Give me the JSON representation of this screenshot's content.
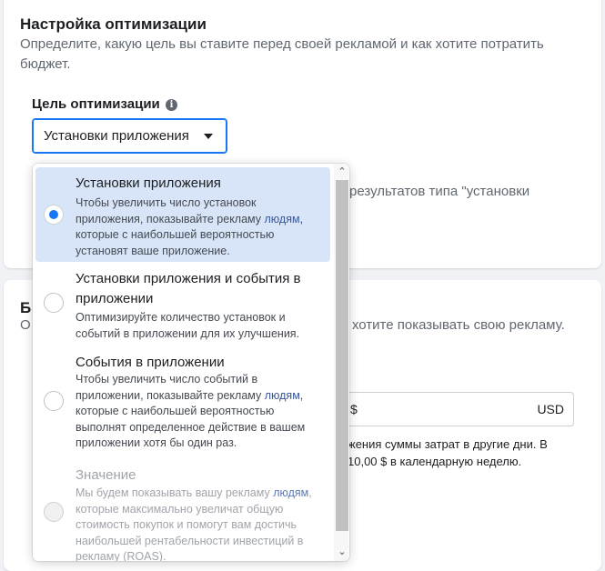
{
  "optimization": {
    "title": "Настройка оптимизации",
    "description": "Определите, какую цель вы ставите перед своей рекламой и как хотите потратить бюджет.",
    "goal_label": "Цель оптимизации",
    "goal_value": "Установки приложения",
    "behind_text": "результатов типа \"установки"
  },
  "budget": {
    "title_partial": "Б",
    "desc_left": "О",
    "desc_right": "ы хотите показывать свою рекламу.",
    "currency_symbol": "$",
    "currency_unit": "USD",
    "note_line1": "жения суммы затрат в другие дни. В",
    "note_line2": "10,00 $ в календарную неделю."
  },
  "dropdown": {
    "options": [
      {
        "title": "Установки приложения",
        "desc_before": "Чтобы увеличить число установок приложения, показывайте рекламу ",
        "link": "людям",
        "desc_after": ", которые с наибольшей вероятностью установят ваше приложение.",
        "selected": true,
        "disabled": false
      },
      {
        "title": "Установки приложения и события в приложении",
        "desc_before": "Оптимизируйте количество установок и событий в приложении для их улучшения.",
        "link": "",
        "desc_after": "",
        "selected": false,
        "disabled": false
      },
      {
        "title": "События в приложении",
        "desc_before": "Чтобы увеличить число событий в приложении, показывайте рекламу ",
        "link": "людям",
        "desc_after": ", которые с наибольшей вероятностью выполнят определенное действие в вашем приложении хотя бы один раз.",
        "selected": false,
        "disabled": false
      },
      {
        "title": "Значение",
        "desc_before": "Мы будем показывать вашу рекламу ",
        "link": "людям",
        "desc_after": ", которые максимально увеличат общую стоимость покупок и помогут вам достичь наибольшей рентабельности инвестиций в рекламу (ROAS).",
        "selected": false,
        "disabled": true
      }
    ]
  },
  "icons": {
    "info": "info-icon",
    "caret": "caret-down-icon",
    "scroll_up": "scroll-up-arrow-icon",
    "scroll_down": "scroll-down-arrow-icon"
  },
  "colors": {
    "accent": "#1877f2",
    "selected_bg": "#d8e5f9",
    "link": "#385898"
  }
}
